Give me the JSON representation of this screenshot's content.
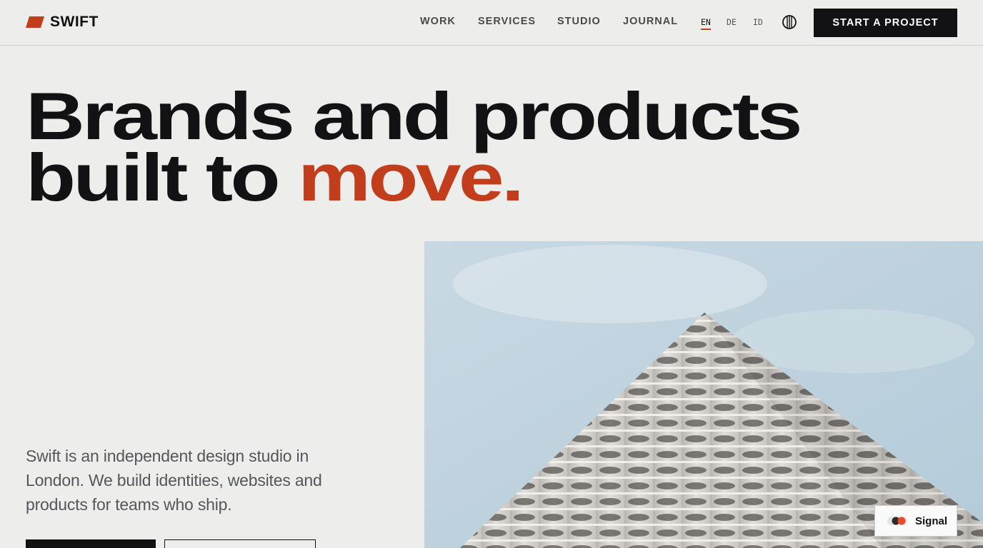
{
  "brand": {
    "name": "SWIFT",
    "accent_color": "#c23d1c",
    "logo_icon": "parallelogram-icon"
  },
  "nav": {
    "items": [
      {
        "label": "WORK"
      },
      {
        "label": "SERVICES"
      },
      {
        "label": "STUDIO"
      },
      {
        "label": "JOURNAL"
      }
    ],
    "languages": [
      {
        "code": "EN",
        "active": true
      },
      {
        "code": "DE",
        "active": false
      },
      {
        "code": "ID",
        "active": false
      }
    ],
    "theme_toggle_icon": "contrast-icon",
    "cta_label": "START A PROJECT"
  },
  "hero": {
    "headline_line1": "Brands and products",
    "headline_line2_prefix": "built to ",
    "headline_accent": "move.",
    "intro": "Swift is an independent design studio in London. We build identities, websites and products for teams who ship.",
    "image_subject": "modern-building-image"
  },
  "badge": {
    "label": "Signal",
    "icon": "toggle-dots-icon"
  }
}
